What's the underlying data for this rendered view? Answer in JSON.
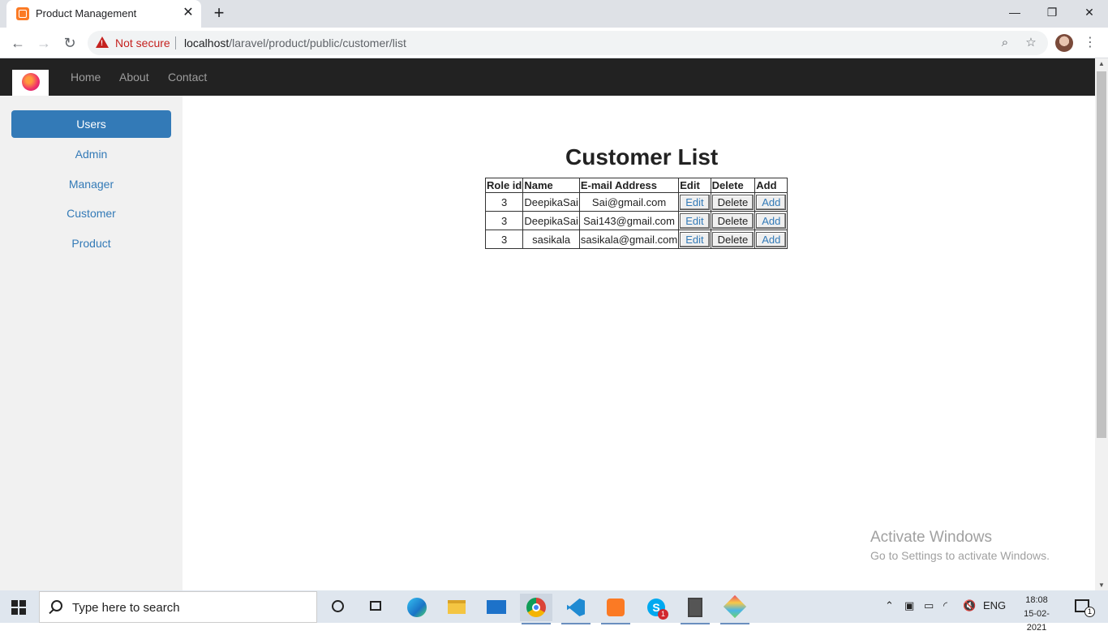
{
  "browser": {
    "tab_title": "Product Management",
    "tab_close": "✕",
    "new_tab": "+",
    "minimize": "—",
    "restore": "❐",
    "close": "✕",
    "not_secure": "Not secure",
    "url_host": "localhost",
    "url_path": "/laravel/product/public/customer/list"
  },
  "navbar": {
    "links": [
      "Home",
      "About",
      "Contact"
    ]
  },
  "sidebar": {
    "items": [
      "Users",
      "Admin",
      "Manager",
      "Customer",
      "Product"
    ]
  },
  "main": {
    "title": "Customer List",
    "columns": [
      "Role id",
      "Name",
      "E-mail Address",
      "Edit",
      "Delete",
      "Add"
    ],
    "rows": [
      {
        "role_id": "3",
        "name": "DeepikaSai",
        "email": "Sai@gmail.com",
        "edit": "Edit",
        "delete": "Delete",
        "add": "Add"
      },
      {
        "role_id": "3",
        "name": "DeepikaSai",
        "email": "Sai143@gmail.com",
        "edit": "Edit",
        "delete": "Delete",
        "add": "Add"
      },
      {
        "role_id": "3",
        "name": "sasikala",
        "email": "sasikala@gmail.com",
        "edit": "Edit",
        "delete": "Delete",
        "add": "Add"
      }
    ]
  },
  "watermark": {
    "line1": "Activate Windows",
    "line2": "Go to Settings to activate Windows."
  },
  "taskbar": {
    "search_placeholder": "Type here to search",
    "language": "ENG",
    "time": "18:08",
    "date": "15-02-2021",
    "notification_count": "1",
    "skype_badge": "1"
  },
  "colors": {
    "accent": "#337ab7",
    "navbar_bg": "#222222",
    "sidebar_bg": "#f1f1f1",
    "warning_red": "#c5221f"
  }
}
